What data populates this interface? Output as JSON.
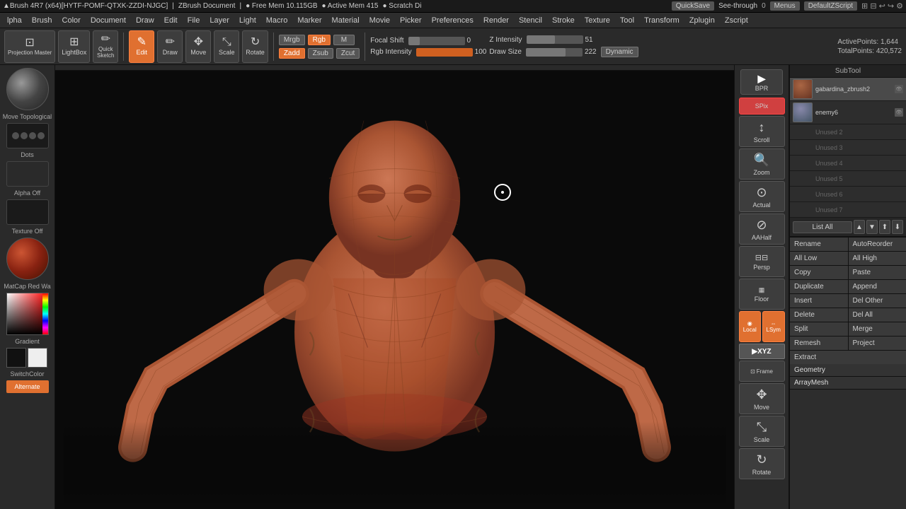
{
  "title": "ZBrush 4R7",
  "topbar": {
    "brush_info": "▲Brush 4R7 (x64)[HYTF-POMF-QTXK-ZZDI-NJGC]",
    "doc_label": "ZBrush Document",
    "free_mem": "● Free Mem 10.115GB",
    "active_mem": "● Active Mem 415",
    "scratch": "● Scratch Di",
    "quicksave": "QuickSave",
    "seethrough": "See-through",
    "seethrough_val": "0",
    "menus": "Menus",
    "default_script": "DefaultZScript"
  },
  "menubar": {
    "items": [
      "lpha",
      "Brush",
      "Color",
      "Document",
      "Draw",
      "Edit",
      "File",
      "Layer",
      "Light",
      "Macro",
      "Marker",
      "Material",
      "Movie",
      "Picker",
      "Preferences",
      "Render",
      "Stencil",
      "Stroke",
      "Texture",
      "Tool",
      "Transform",
      "Zplugin",
      "Zscript"
    ]
  },
  "toolbar": {
    "projection_master": "Projection\nMaster",
    "lightbox": "LightBox",
    "quick_sketch": "Quick\nSketch",
    "edit_label": "Edit",
    "draw_label": "Draw",
    "move_label": "Move",
    "scale_label": "Scale",
    "rotate_label": "Rotate",
    "mrgb_label": "Mrgb",
    "rgb_label": "Rgb",
    "m_label": "M",
    "zadd_label": "Zadd",
    "zsub_label": "Zsub",
    "zcut_label": "Zcut",
    "focal_label": "Focal Shift",
    "focal_val": "0",
    "active_points_label": "ActivePoints:",
    "active_points_val": "1,644",
    "rgb_intensity_label": "Rgb Intensity",
    "rgb_intensity_val": "100",
    "z_intensity_label": "Z Intensity",
    "z_intensity_val": "51",
    "draw_size_label": "Draw Size",
    "draw_size_val": "222",
    "dynamic_label": "Dynamic",
    "total_points_label": "TotalPoints:",
    "total_points_val": "420,572"
  },
  "left_sidebar": {
    "move_topological": "Move Topological",
    "dots_label": "Dots",
    "alpha_off": "Alpha Off",
    "texture_off": "Texture Off",
    "matcap_label": "MatCap Red Wa",
    "gradient_label": "Gradient",
    "switch_color": "SwitchColor",
    "alternate_label": "Alternate"
  },
  "right_tools": {
    "bpr_label": "BPR",
    "spix_label": "SPix",
    "scroll_label": "Scroll",
    "zoom_label": "Zoom",
    "actual_label": "Actual",
    "aahalf_label": "AAHalf",
    "persp_label": "Persp",
    "floor_label": "Floor",
    "local_label": "Local",
    "lsym_label": "LSym",
    "xyz_label": "▶XYZ",
    "frame_label": "Frame",
    "move_label": "Move",
    "scale_label": "Scale",
    "rotate_label": "Rotate"
  },
  "subtool": {
    "header": "SubTool",
    "items": [
      {
        "name": "gabardina_zbrush2",
        "type": "figure"
      },
      {
        "name": "enemy6",
        "type": "enemy"
      },
      {
        "name": "Unused 2",
        "type": "unused"
      },
      {
        "name": "Unused 3",
        "type": "unused"
      },
      {
        "name": "Unused 4",
        "type": "unused"
      },
      {
        "name": "Unused 5",
        "type": "unused"
      },
      {
        "name": "Unused 6",
        "type": "unused"
      },
      {
        "name": "Unused 7",
        "type": "unused"
      }
    ],
    "list_all": "List All"
  },
  "right_panel": {
    "buttons": {
      "rename": "Rename",
      "auto_reorder": "AutoReorder",
      "all_low": "All Low",
      "all_high": "All High",
      "copy": "Copy",
      "paste": "Paste",
      "duplicate": "Duplicate",
      "append": "Append",
      "insert": "Insert",
      "del_other": "Del Other",
      "delete_btn": "Delete",
      "del_all": "Del All",
      "split": "Split",
      "merge": "Merge",
      "remesh": "Remesh",
      "project": "Project",
      "extract": "Extract",
      "geometry": "Geometry",
      "array_mesh": "ArrayMesh"
    }
  },
  "model": {
    "description": "Human figure in T-pose, clay/terracotta color, wireframe visible"
  }
}
